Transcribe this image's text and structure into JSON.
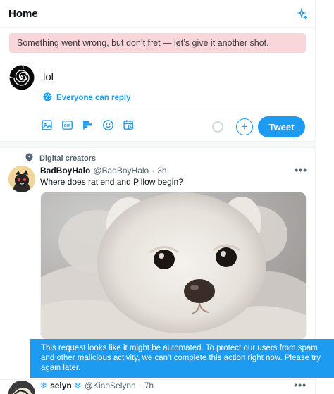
{
  "header": {
    "title": "Home"
  },
  "error_banner": {
    "text": "Something went wrong, but don’t fret — let’s give it another shot."
  },
  "composer": {
    "text": "lol",
    "reply_setting": "Everyone can reply",
    "tweet_button": "Tweet",
    "add_button": "+",
    "tools": [
      "image-icon",
      "gif-icon",
      "poll-icon",
      "emoji-icon",
      "schedule-icon"
    ]
  },
  "tweet1": {
    "social_context": "Digital creators",
    "name": "BadBoyHalo",
    "handle": "@BadBoyHalo",
    "dot": "·",
    "time": "3h",
    "text": "Where does rat end and Pillow begin?",
    "more": "•••"
  },
  "toast": {
    "text": "This request looks like it might be automated. To protect our users from spam and other malicious activity, we can't complete this action right now. Please try again later."
  },
  "tweet2": {
    "snow_left": "❄",
    "name": "selyn",
    "snow_right": "❄",
    "handle": "@KinoSelynn",
    "dot": "·",
    "time": "7h",
    "more": "•••"
  },
  "colors": {
    "accent": "#1d9bf0",
    "error_bg": "#f9d6da"
  }
}
